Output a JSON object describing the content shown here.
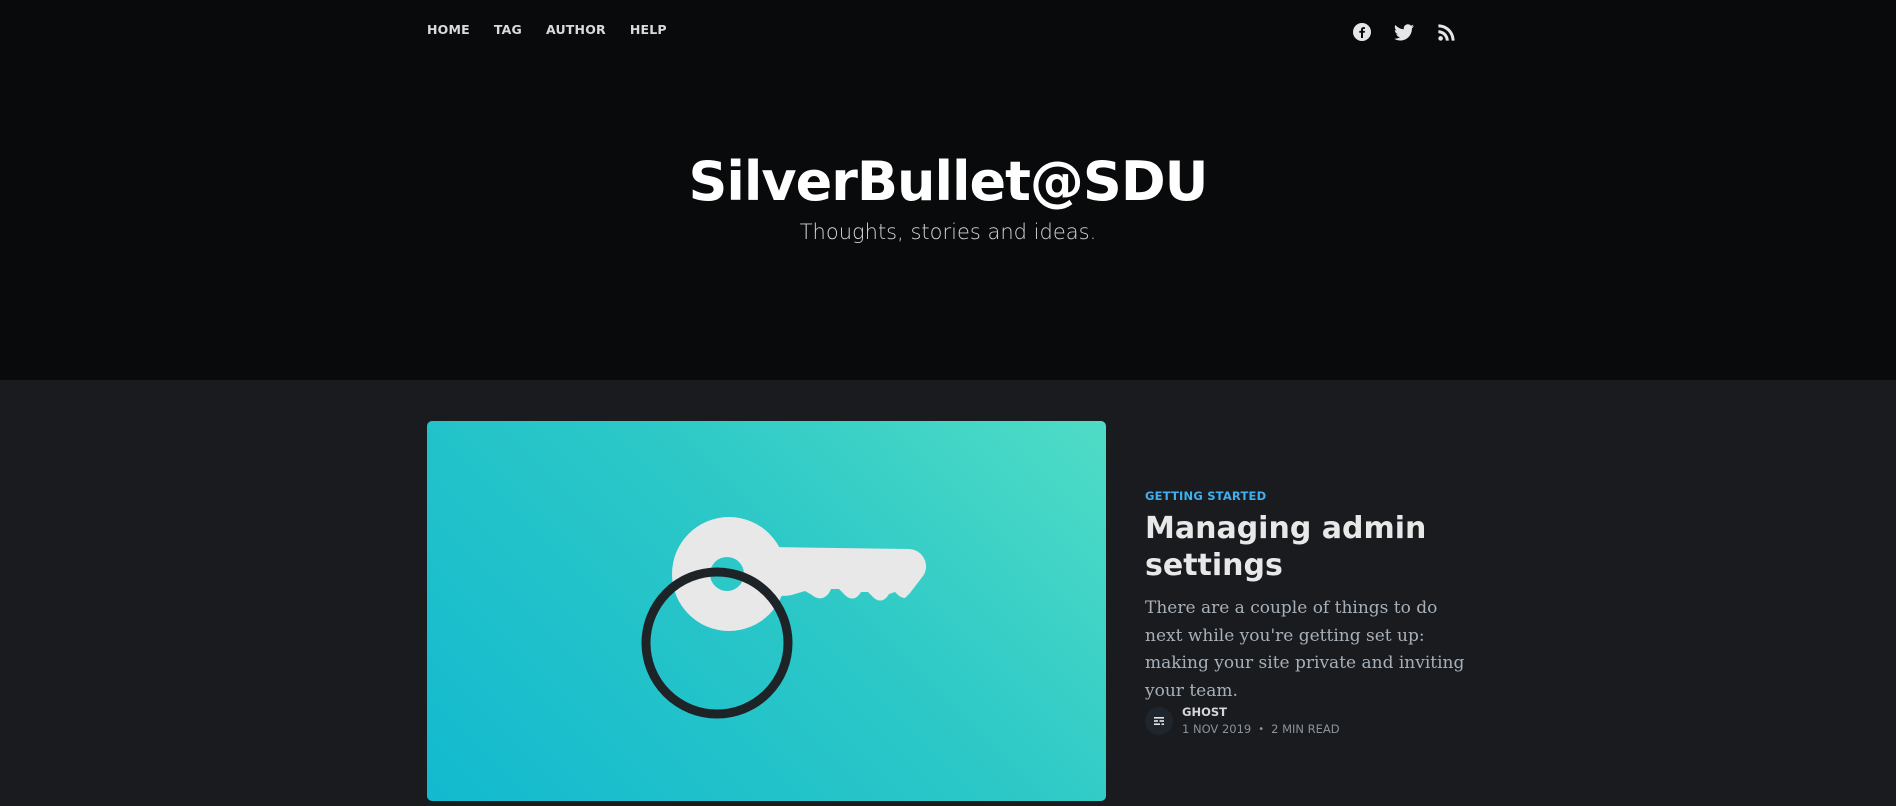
{
  "nav": {
    "items": [
      {
        "label": "Home"
      },
      {
        "label": "Tag"
      },
      {
        "label": "Author"
      },
      {
        "label": "Help"
      }
    ]
  },
  "social": {
    "icons": [
      "facebook-icon",
      "twitter-icon",
      "rss-icon"
    ]
  },
  "site": {
    "title": "SilverBullet@SDU",
    "description": "Thoughts, stories and ideas."
  },
  "post": {
    "tag": "Getting Started",
    "title": "Managing admin settings",
    "excerpt": "There are a couple of things to do next while you're getting set up: making your site private and inviting your team.",
    "author": "Ghost",
    "date": "1 Nov 2019",
    "separator": "•",
    "reading_time": "2 min read",
    "image_icon": "key-icon"
  },
  "colors": {
    "header_bg": "#090a0b",
    "page_bg": "#191b1f",
    "accent": "#3eb0ef",
    "image_gradient_start": "#4fdcc6",
    "image_gradient_end": "#12b9cf"
  }
}
